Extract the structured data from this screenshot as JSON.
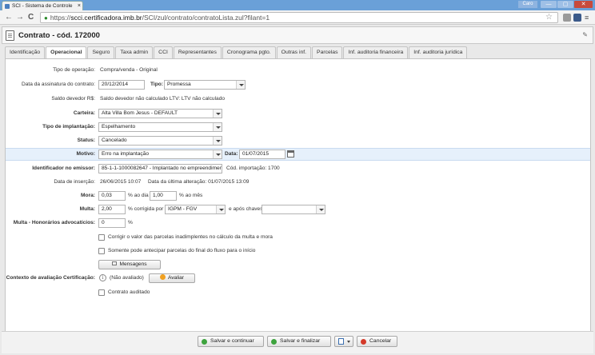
{
  "browser": {
    "tab_title": "SCI - Sistema de Controle",
    "tab_close": "×",
    "user_badge": "Caro",
    "minimize": "—",
    "maximize": "▢",
    "close": "✕",
    "url_scheme": "https://",
    "url_host": "scci.certificadora.imb.br",
    "url_path": "/SCI/zul/contrato/contratoLista.zul?filant=1",
    "back": "←",
    "forward": "→",
    "reload": "C",
    "bookmark": "☆"
  },
  "app": {
    "title": "Contrato - cód. 172000",
    "tabs": [
      {
        "label": "Identificação"
      },
      {
        "label": "Operacional"
      },
      {
        "label": "Seguro"
      },
      {
        "label": "Taxa admin"
      },
      {
        "label": "CCI"
      },
      {
        "label": "Representantes"
      },
      {
        "label": "Cronograma pgto."
      },
      {
        "label": "Outras inf."
      },
      {
        "label": "Parcelas"
      },
      {
        "label": "Inf. auditoria financeira"
      },
      {
        "label": "Inf. auditoria jurídica"
      }
    ],
    "active_tab": "Operacional"
  },
  "form": {
    "tipo_operacao": {
      "label": "Tipo de operação:",
      "value": "Compra/venda - Original"
    },
    "data_assinatura": {
      "label": "Data da assinatura do contrato:",
      "value": "20/12/2014"
    },
    "tipo": {
      "label": "Tipo:",
      "value": "Promessa"
    },
    "saldo_devedor": {
      "label": "Saldo devedor R$:",
      "value": "Saldo devedor não calculado  LTV: LTV não calculado"
    },
    "carteira": {
      "label": "Carteira:",
      "value": "Alta Villa Bom Jesus - DEFAULT"
    },
    "tipo_implantacao": {
      "label": "Tipo de implantação:",
      "value": "Espelhamento"
    },
    "status": {
      "label": "Status:",
      "value": "Cancelado"
    },
    "motivo": {
      "label": "Motivo:",
      "value": "Erro na implantação"
    },
    "data": {
      "label": "Data:",
      "value": "01/07/2015"
    },
    "identificador_emissor": {
      "label": "Identificador no emissor:",
      "value": "85-1-1-1000082647 - Implantado no empreendiment"
    },
    "cod_importacao": "Cód. importação: 1700",
    "data_insercao": {
      "label": "Data de inserção:",
      "value": "26/06/2015 10:07"
    },
    "data_ultima_alteracao": "Data da última alteração: 01/07/2015 13:09",
    "mora": {
      "label": "Mora:",
      "value1": "0,03",
      "suffix1": "% ao dia",
      "value2": "1,00",
      "suffix2": "% ao mês"
    },
    "multa": {
      "label": "Multa:",
      "value": "2,00",
      "suffix": "% corrigida por",
      "indice": "IGPM - FGV",
      "apos": "e após chaves",
      "apos_value": ""
    },
    "multa_honorarios": {
      "label": "Multa - Honorários advocatícios:",
      "value": "0",
      "suffix": "%"
    },
    "corrigir_valor": "Corrigir o valor das parcelas inadimplentes no cálculo da multa e mora",
    "somente_antecipar": "Somente pode antecipar parcelas do final do fluxo para o início",
    "mensagens_button": "Mensagens",
    "contexto_avaliacao": {
      "label": "Contexto de avaliação Certificação:",
      "info": "i",
      "value": "(Não avaliado)",
      "button": "Avaliar"
    },
    "contrato_auditado": "Contrato auditado"
  },
  "footer": {
    "salvar_continuar": "Salvar e continuar",
    "salvar_finalizar": "Salvar e finalizar",
    "cancelar": "Cancelar"
  }
}
